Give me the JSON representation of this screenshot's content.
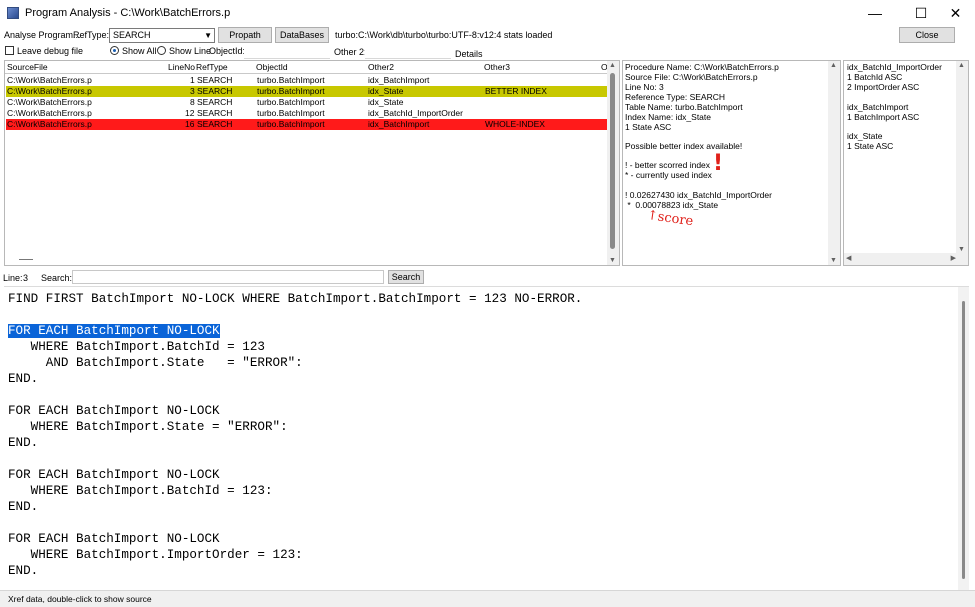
{
  "window": {
    "title": "Program Analysis - C:\\Work\\BatchErrors.p",
    "minimize_glyph": "—",
    "maximize_glyph": "☐",
    "close_glyph": "✕"
  },
  "toolbar": {
    "analyse_label": "Analyse Program...",
    "reftype_label": "RefType:",
    "reftype_value": "SEARCH",
    "propath_label": "Propath",
    "databases_label": "DataBases",
    "db_status": "turbo:C:\\Work\\db\\turbo\\turbo:UTF-8:v12:4 stats loaded",
    "close_label": "Close",
    "leave_debug_label": "Leave debug file",
    "show_all_label": "Show All",
    "show_line_label": "Show Line",
    "objectid_label": "ObjectId:",
    "objectid_value": "",
    "other2_label": "Other 2:",
    "other2_value": "",
    "details_label": "Details"
  },
  "xref": {
    "columns": [
      "SourceFile",
      "LineNo",
      "RefType",
      "ObjectId",
      "Other2",
      "Other3",
      "O"
    ],
    "rows": [
      {
        "source": "C:\\Work\\BatchErrors.p",
        "line": "1",
        "reftype": "SEARCH",
        "objectid": "turbo.BatchImport",
        "other2": "idx_BatchImport",
        "other3": ""
      },
      {
        "source": "C:\\Work\\BatchErrors.p",
        "line": "3",
        "reftype": "SEARCH",
        "objectid": "turbo.BatchImport",
        "other2": "idx_State",
        "other3": "BETTER INDEX"
      },
      {
        "source": "C:\\Work\\BatchErrors.p",
        "line": "8",
        "reftype": "SEARCH",
        "objectid": "turbo.BatchImport",
        "other2": "idx_State",
        "other3": ""
      },
      {
        "source": "C:\\Work\\BatchErrors.p",
        "line": "12",
        "reftype": "SEARCH",
        "objectid": "turbo.BatchImport",
        "other2": "idx_BatchId_ImportOrder",
        "other3": ""
      },
      {
        "source": "C:\\Work\\BatchErrors.p",
        "line": "16",
        "reftype": "SEARCH",
        "objectid": "turbo.BatchImport",
        "other2": "idx_BatchImport",
        "other3": "WHOLE-INDEX"
      }
    ]
  },
  "details": {
    "lines": [
      "Procedure Name: C:\\Work\\BatchErrors.p",
      "Source File: C:\\Work\\BatchErrors.p",
      "Line No: 3",
      "Reference Type: SEARCH",
      "Table Name: turbo.BatchImport",
      "Index Name: idx_State",
      "1 State ASC",
      "",
      "Possible better index available!",
      "",
      "! - better scorred index",
      "* - currently used index",
      "",
      "!   0.02627430 idx_BatchId_ImportOrder",
      " *  0.00078823 idx_State"
    ],
    "annotation_score": "↑score",
    "annotation_mark": "!"
  },
  "indexes": {
    "lines": [
      "idx_BatchId_ImportOrder",
      "1 BatchId ASC",
      "2 ImportOrder ASC",
      "",
      "idx_BatchImport",
      "1 BatchImport ASC",
      "",
      "idx_State",
      "1 State ASC"
    ]
  },
  "search": {
    "line_label": "Line:",
    "line_value": "3",
    "search_label": "Search:",
    "search_value": "",
    "search_button": "Search"
  },
  "editor": {
    "lines": [
      "FIND FIRST BatchImport NO-LOCK WHERE BatchImport.BatchImport = 123 NO-ERROR.",
      "",
      "FOR EACH BatchImport NO-LOCK",
      "   WHERE BatchImport.BatchId = 123",
      "     AND BatchImport.State   = \"ERROR\":",
      "END.",
      "",
      "FOR EACH BatchImport NO-LOCK",
      "   WHERE BatchImport.State = \"ERROR\":",
      "END.",
      "",
      "FOR EACH BatchImport NO-LOCK",
      "   WHERE BatchImport.BatchId = 123:",
      "END.",
      "",
      "FOR EACH BatchImport NO-LOCK",
      "   WHERE BatchImport.ImportOrder = 123:",
      "END."
    ]
  },
  "status": {
    "text": "Xref data, double-click to show source"
  },
  "colors": {
    "selected_row": "#c8c800",
    "error_row": "#ff1a1a",
    "highlight": "#0a64d8",
    "annotation": "#e0201a"
  }
}
